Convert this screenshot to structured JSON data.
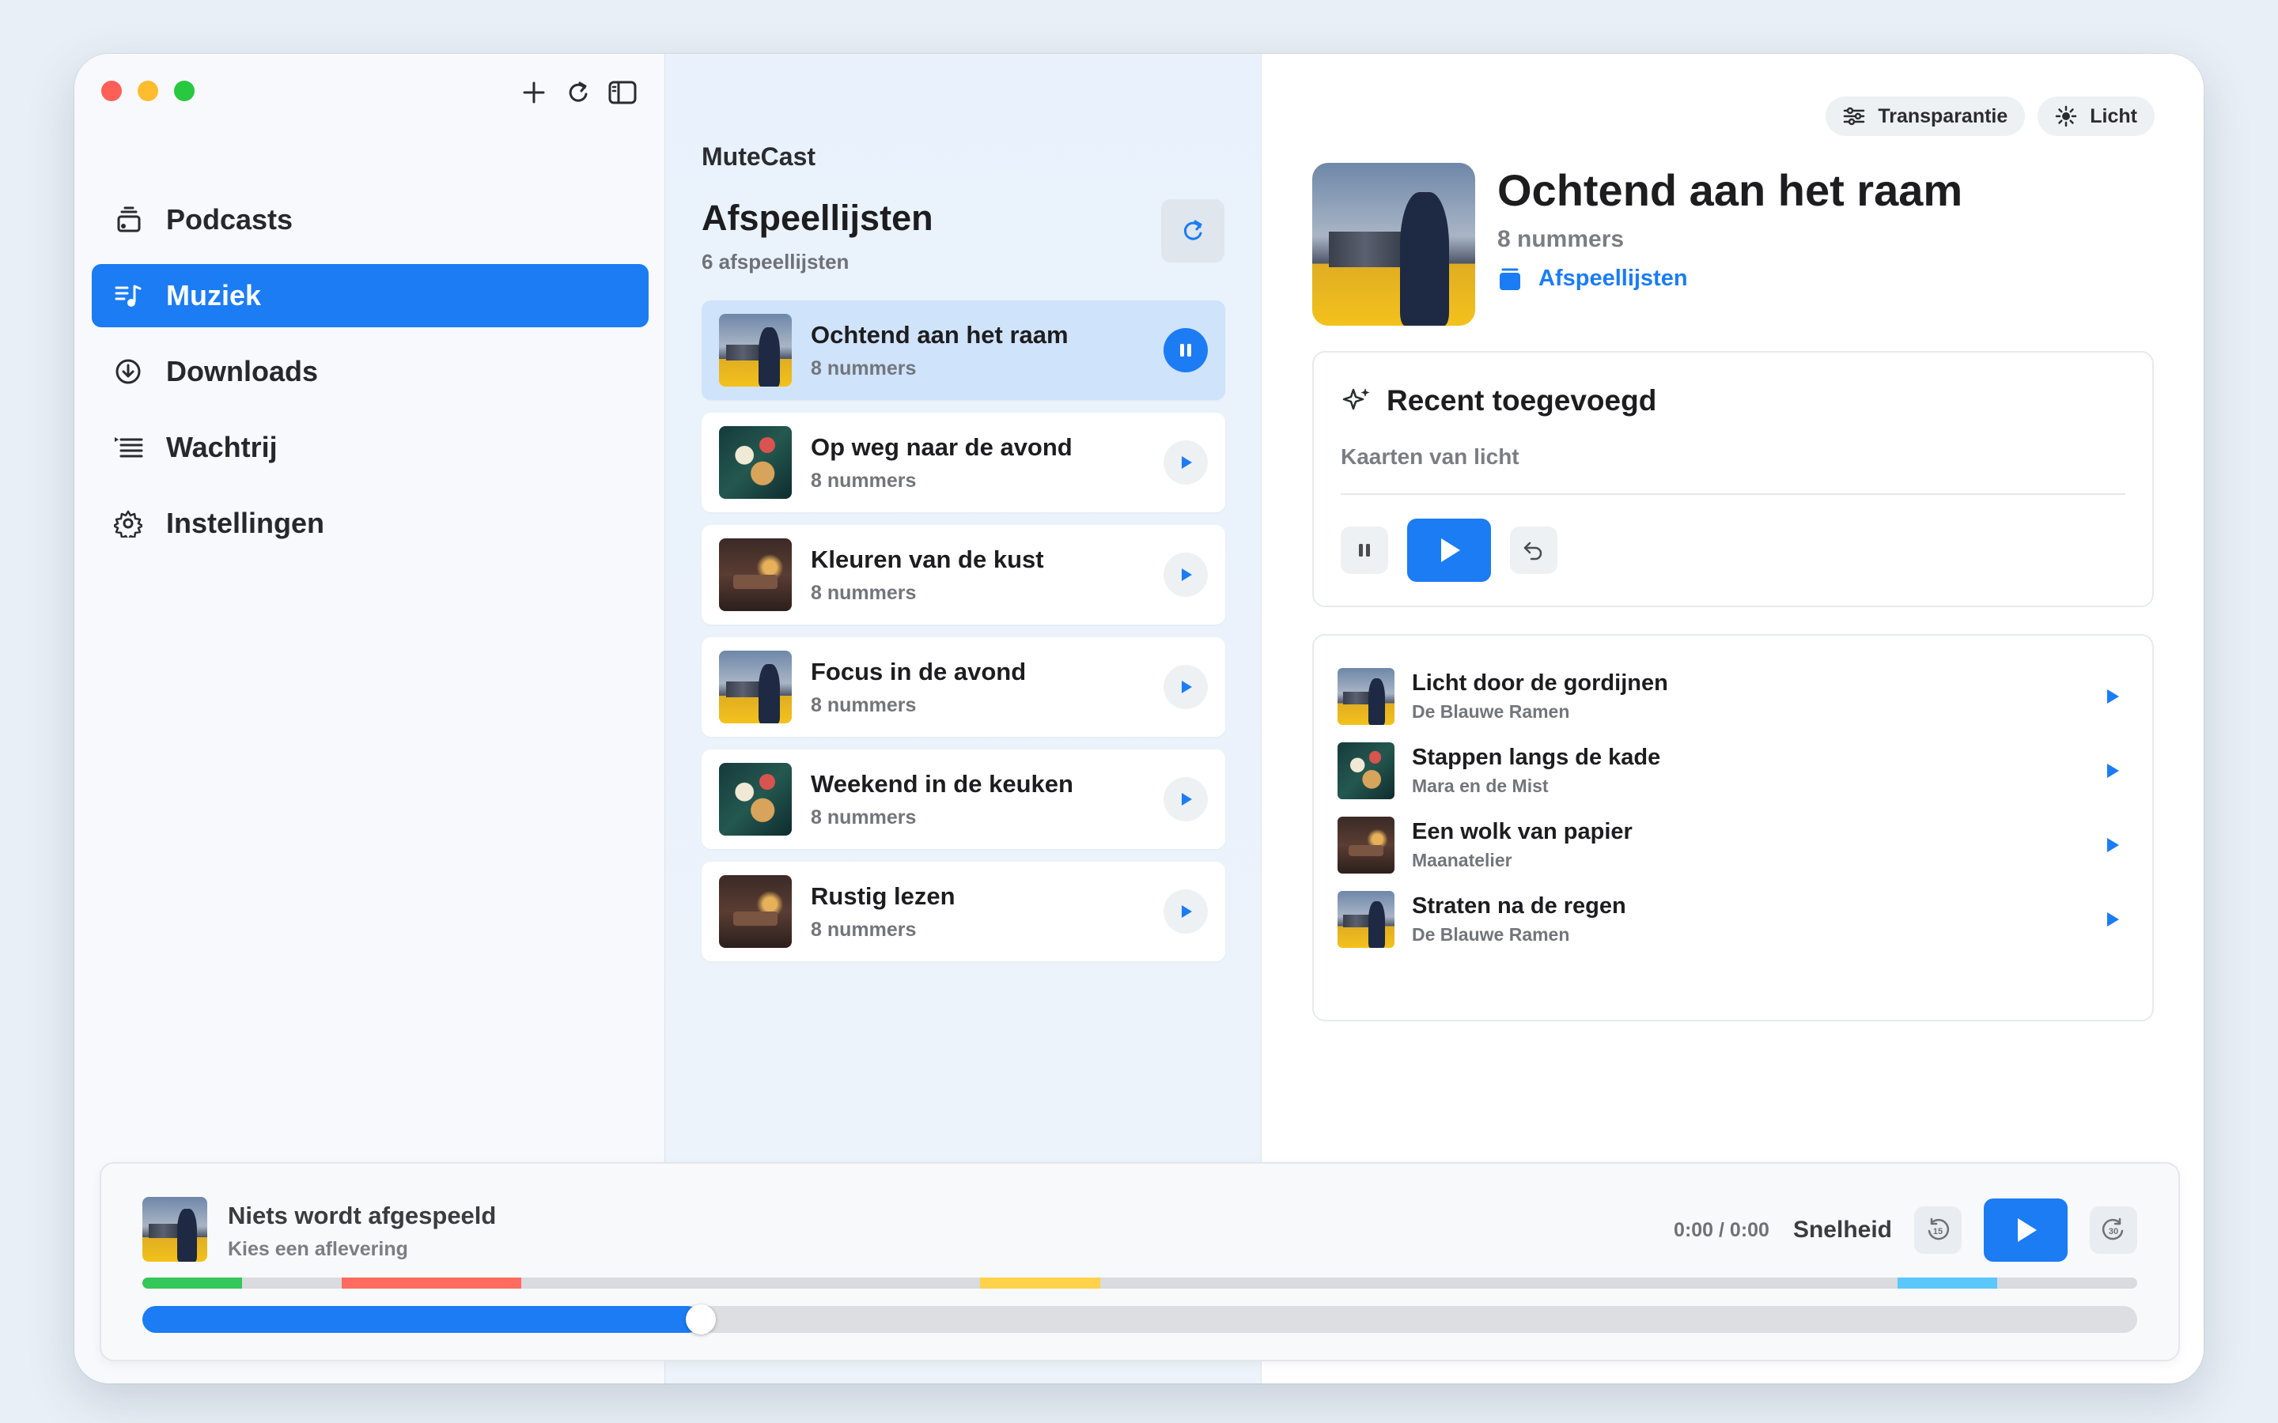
{
  "window": {
    "sidebar_tools": [
      "plus-icon",
      "refresh-icon",
      "sidebar-toggle-icon"
    ]
  },
  "sidebar": {
    "items": [
      {
        "label": "Podcasts",
        "icon": "podcast-stack-icon",
        "active": false
      },
      {
        "label": "Muziek",
        "icon": "music-list-icon",
        "active": true
      },
      {
        "label": "Downloads",
        "icon": "download-circle-icon",
        "active": false
      },
      {
        "label": "Wachtrij",
        "icon": "queue-list-icon",
        "active": false
      },
      {
        "label": "Instellingen",
        "icon": "gear-icon",
        "active": false
      }
    ]
  },
  "middle": {
    "app_name": "MuteCast",
    "title": "Afspeellijsten",
    "count": "6 afspeellijsten",
    "playlists": [
      {
        "name": "Ochtend aan het raam",
        "sub": "8 nummers",
        "art": "city",
        "state": "playing"
      },
      {
        "name": "Op weg naar de avond",
        "sub": "8 nummers",
        "art": "map",
        "state": "paused"
      },
      {
        "name": "Kleuren van de kust",
        "sub": "8 nummers",
        "art": "room",
        "state": "paused"
      },
      {
        "name": "Focus in de avond",
        "sub": "8 nummers",
        "art": "city",
        "state": "paused"
      },
      {
        "name": "Weekend in de keuken",
        "sub": "8 nummers",
        "art": "map",
        "state": "paused"
      },
      {
        "name": "Rustig lezen",
        "sub": "8 nummers",
        "art": "room",
        "state": "paused"
      }
    ]
  },
  "detail": {
    "pills": {
      "transparency": "Transparantie",
      "theme": "Licht"
    },
    "title": "Ochtend aan het raam",
    "subtitle": "8 nummers",
    "link": "Afspeellijsten",
    "recent": {
      "heading": "Recent toegevoegd",
      "track": "Kaarten van licht"
    },
    "tracks": [
      {
        "name": "Licht door de gordijnen",
        "artist": "De Blauwe Ramen",
        "art": "city"
      },
      {
        "name": "Stappen langs de kade",
        "artist": "Mara en de Mist",
        "art": "map"
      },
      {
        "name": "Een wolk van papier",
        "artist": "Maanatelier",
        "art": "room"
      },
      {
        "name": "Straten na de regen",
        "artist": "De Blauwe Ramen",
        "art": "city"
      }
    ]
  },
  "player": {
    "title": "Niets wordt afgespeeld",
    "subtitle": "Kies een aflevering",
    "time": "0:00 / 0:00",
    "speed_label": "Snelheid",
    "skip_back": "15",
    "skip_forward": "30",
    "progress_fraction": 0.28,
    "chapter_segments": [
      {
        "start": 0.0,
        "end": 0.05,
        "color": "#34c759"
      },
      {
        "start": 0.1,
        "end": 0.19,
        "color": "#ff6b5e"
      },
      {
        "start": 0.42,
        "end": 0.48,
        "color": "#ffd24a"
      },
      {
        "start": 0.88,
        "end": 0.93,
        "color": "#5ac8fa"
      }
    ]
  },
  "colors": {
    "accent": "#1b7cf4",
    "active_row": "#cfe3fb"
  }
}
